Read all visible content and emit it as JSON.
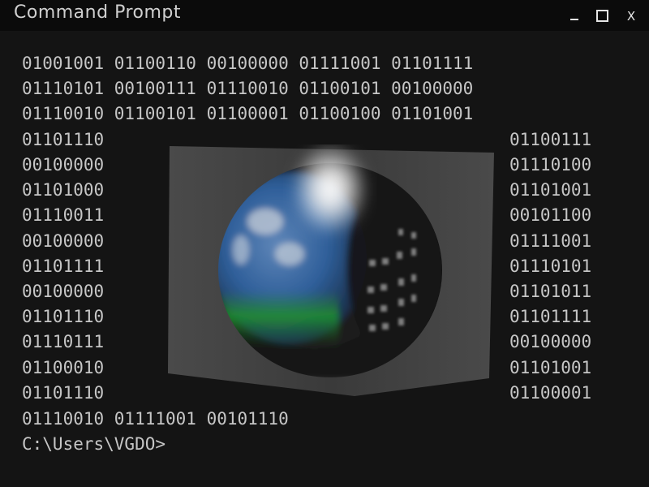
{
  "window": {
    "title": "Command Prompt",
    "minimize_icon": "minimize-icon",
    "maximize_icon": "maximize-icon",
    "close_label": "X"
  },
  "console": {
    "full_lines": [
      "01001001 01100110 00100000 01111001 01101111",
      "01110101 00100111 01110010 01100101 00100000",
      "01110010 01100101 01100001 01100100 01101001"
    ],
    "left_column": [
      "01101110",
      "00100000",
      "01101000",
      "01110011",
      "00100000",
      "01101111",
      "00100000",
      "01101110",
      "01110111",
      "01100010",
      "01101110"
    ],
    "right_column": [
      "01100111",
      "01110100",
      "01101001",
      "00101100",
      "01111001",
      "01110101",
      "01101011",
      "01101111",
      "00100000",
      "01101001",
      "01100001"
    ],
    "last_line": "01110010 01111001 00101110",
    "prompt": "C:\\Users\\VGDO>"
  },
  "colors": {
    "background": "#141414",
    "titlebar": "#0b0b0b",
    "text": "#c6c6c6"
  }
}
